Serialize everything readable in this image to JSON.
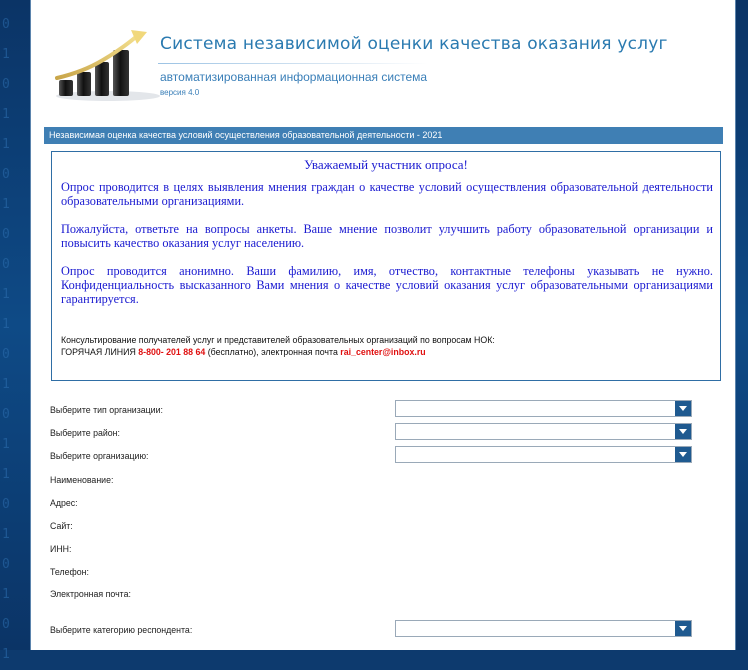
{
  "header": {
    "title": "Система независимой оценки качества оказания услуг",
    "subtitle": "автоматизированная информационная система",
    "version": "версия 4.0"
  },
  "section": {
    "title": "Независимая оценка качества условий осуществления образовательной деятельности - 2021"
  },
  "notice": {
    "greeting": "Уважаемый участник опроса!",
    "paragraph1": "Опрос проводится в целях выявления мнения граждан о качестве условий осуществления образовательной деятельности образовательными организациями.",
    "paragraph2": "Пожалуйста, ответьте на вопросы анкеты. Ваше мнение позволит улучшить работу образовательной организации и повысить качество оказания услуг населению.",
    "paragraph3": "Опрос проводится анонимно. Ваши фамилию, имя, отчество, контактные телефоны указывать не нужно. Конфиденциальность высказанного Вами мнения о качестве условий оказания услуг образовательными организациями гарантируется.",
    "consult_line1": "Консультирование получателей услуг и представителей образовательных организаций по вопросам НОК:",
    "hotline_label": "ГОРЯЧАЯ ЛИНИЯ",
    "hotline_phone": "8-800- 201 88 64",
    "hotline_free": "(бесплатно), электронная почта",
    "email": "rai_center@inbox.ru"
  },
  "form": {
    "org_type_label": "Выберите тип организации:",
    "org_type_value": "",
    "district_label": "Выберите район:",
    "district_value": "",
    "org_label": "Выберите организацию:",
    "org_value": "",
    "name_label": "Наименование:",
    "address_label": "Адрес:",
    "site_label": "Сайт:",
    "inn_label": "ИНН:",
    "phone_label": "Телефон:",
    "email_label": "Электронная почта:",
    "respondent_label": "Выберите категорию респондента:",
    "respondent_value": ""
  },
  "colors": {
    "brand": "#2a7ab0",
    "section_bar": "#3f7fb4",
    "notice_text": "#1a1ad0",
    "accent_red": "#e01010",
    "select_arrow": "#1f5a90"
  }
}
